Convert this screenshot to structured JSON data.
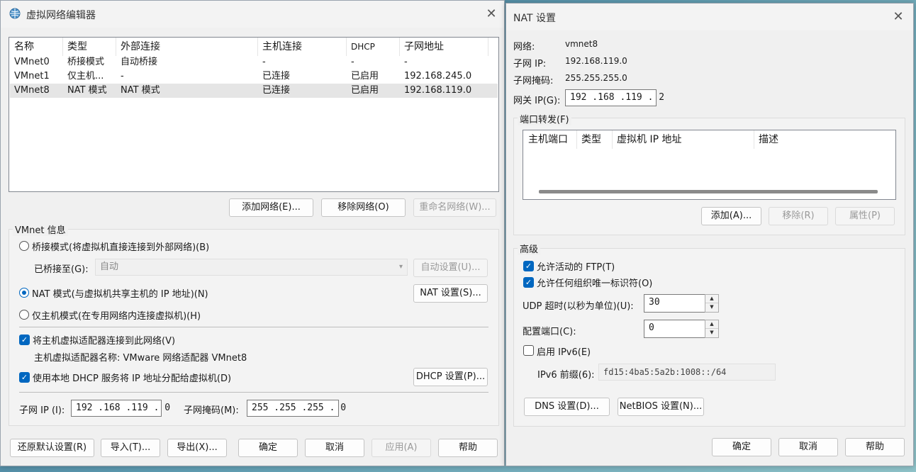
{
  "vne": {
    "title": "虚拟网络编辑器",
    "columns": [
      "名称",
      "类型",
      "外部连接",
      "主机连接",
      "DHCP",
      "子网地址"
    ],
    "rows": [
      [
        "VMnet0",
        "桥接模式",
        "自动桥接",
        "-",
        "-",
        "-"
      ],
      [
        "VMnet1",
        "仅主机...",
        "-",
        "已连接",
        "已启用",
        "192.168.245.0"
      ],
      [
        "VMnet8",
        "NAT 模式",
        "NAT 模式",
        "已连接",
        "已启用",
        "192.168.119.0"
      ]
    ],
    "add_network": "添加网络(E)...",
    "remove_network": "移除网络(O)",
    "rename_network": "重命名网络(W)...",
    "vmnet_info": "VMnet 信息",
    "bridged_label": "桥接模式(将虚拟机直接连接到外部网络)(B)",
    "bridged_to_label": "已桥接至(G):",
    "bridged_to_value": "自动",
    "auto_settings": "自动设置(U)...",
    "nat_label": "NAT 模式(与虚拟机共享主机的 IP 地址)(N)",
    "nat_settings": "NAT 设置(S)...",
    "hostonly_label": "仅主机模式(在专用网络内连接虚拟机)(H)",
    "connect_adapter_label": "将主机虚拟适配器连接到此网络(V)",
    "adapter_name_label": "主机虚拟适配器名称: VMware 网络适配器 VMnet8",
    "use_dhcp_label": "使用本地 DHCP 服务将 IP 地址分配给虚拟机(D)",
    "dhcp_settings": "DHCP 设置(P)...",
    "subnet_ip_label": "子网 IP (I):",
    "subnet_ip": "192 .168 .119 . 0",
    "subnet_mask_label": "子网掩码(M):",
    "subnet_mask": "255 .255 .255 . 0",
    "restore_defaults": "还原默认设置(R)",
    "import": "导入(T)...",
    "export": "导出(X)...",
    "ok": "确定",
    "cancel": "取消",
    "apply": "应用(A)",
    "help": "帮助"
  },
  "nat": {
    "title": "NAT 设置",
    "network_label": "网络:",
    "network_value": "vmnet8",
    "subnet_ip_label": "子网 IP:",
    "subnet_ip_value": "192.168.119.0",
    "subnet_mask_label": "子网掩码:",
    "subnet_mask_value": "255.255.255.0",
    "gateway_label": "网关 IP(G):",
    "gateway_value": "192 .168 .119 . 2",
    "port_forwarding": "端口转发(F)",
    "pf_columns": [
      "主机端口",
      "类型",
      "虚拟机 IP 地址",
      "描述"
    ],
    "add": "添加(A)...",
    "remove": "移除(R)",
    "properties": "属性(P)",
    "advanced": "高级",
    "allow_ftp": "允许活动的 FTP(T)",
    "allow_oui": "允许任何组织唯一标识符(O)",
    "udp_timeout_label": "UDP 超时(以秒为单位)(U):",
    "udp_timeout_value": "30",
    "config_port_label": "配置端口(C):",
    "config_port_value": "0",
    "enable_ipv6": "启用 IPv6(E)",
    "ipv6_prefix_label": "IPv6 前缀(6):",
    "ipv6_prefix_value": "fd15:4ba5:5a2b:1008::/64",
    "dns_settings": "DNS 设置(D)...",
    "netbios_settings": "NetBIOS 设置(N)...",
    "ok": "确定",
    "cancel": "取消",
    "help": "帮助"
  }
}
